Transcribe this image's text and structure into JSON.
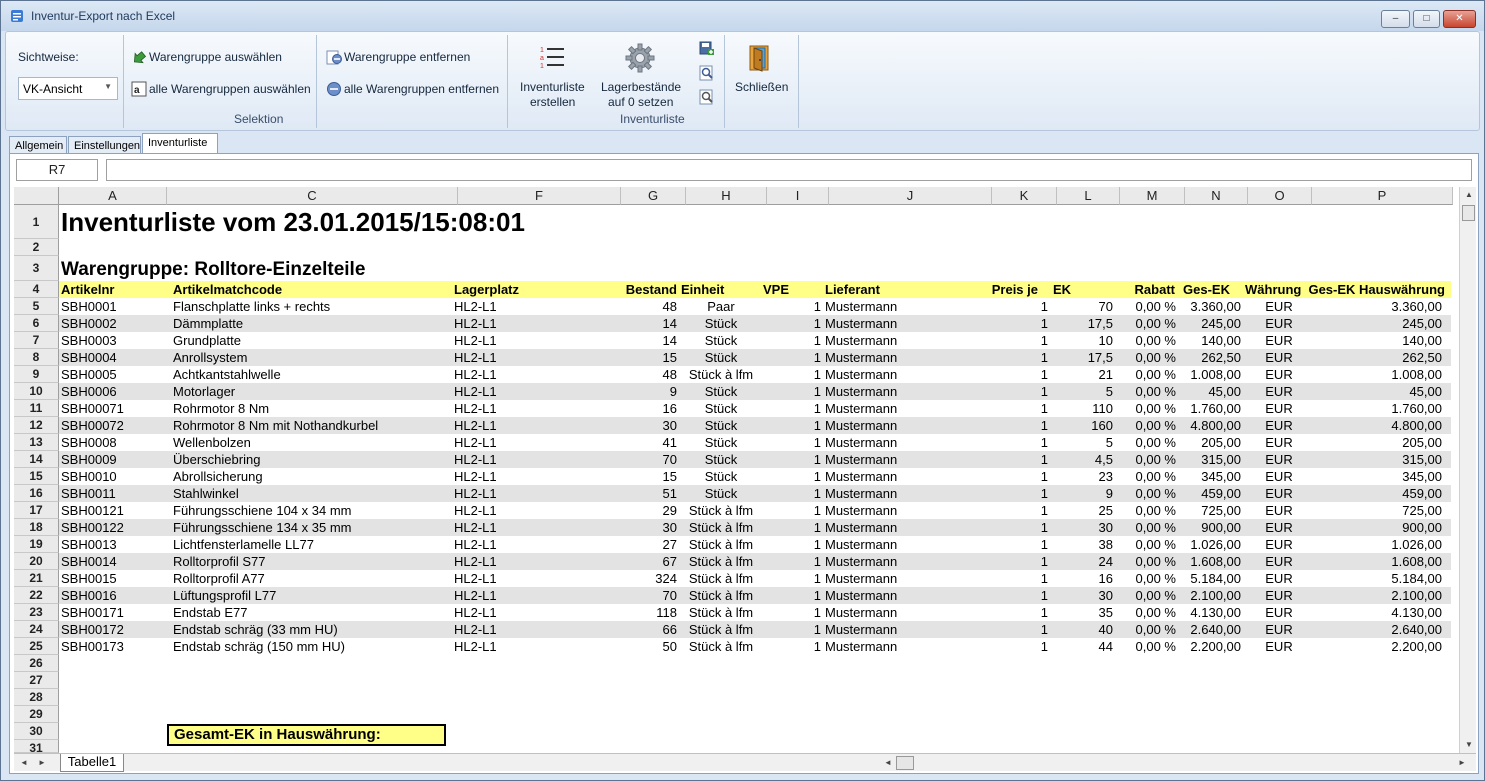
{
  "window": {
    "title": "Inventur-Export nach Excel",
    "minimize": "–",
    "maximize": "□",
    "close": "✕"
  },
  "ribbon": {
    "view_label": "Sichtweise:",
    "view_value": "VK-Ansicht",
    "select_group": "Warengruppe auswählen",
    "select_all_groups": "alle Warengruppen auswählen",
    "remove_group": "Warengruppe entfernen",
    "remove_all_groups": "alle Warengruppen entfernen",
    "selection_group_label": "Selektion",
    "create_list": "Inventurliste erstellen",
    "create_list_l1": "Inventurliste",
    "create_list_l2": "erstellen",
    "reset_stock_l1": "Lagerbestände",
    "reset_stock_l2": "auf 0 setzen",
    "inventory_group_label": "Inventurliste",
    "close": "Schließen"
  },
  "tabs": [
    "Allgemein",
    "Einstellungen",
    "Inventurliste"
  ],
  "active_tab": "Inventurliste",
  "spreadsheet": {
    "name_box": "R7",
    "formula": "",
    "columns": [
      "A",
      "C",
      "F",
      "G",
      "H",
      "I",
      "J",
      "K",
      "L",
      "M",
      "N",
      "O",
      "P"
    ],
    "row_numbers": [
      "1",
      "2",
      "3",
      "4",
      "5",
      "6",
      "7",
      "8",
      "9",
      "10",
      "11",
      "12",
      "13",
      "14",
      "15",
      "16",
      "17",
      "18",
      "19",
      "20",
      "21",
      "22",
      "23",
      "24",
      "25",
      "26",
      "27",
      "28",
      "29",
      "30",
      "31"
    ],
    "title": "Inventurliste vom 23.01.2015/15:08:01",
    "subtitle": "Warengruppe: Rolltore-Einzelteile",
    "headers": [
      "Artikelnr",
      "Artikelmatchcode",
      "Lagerplatz",
      "Bestand",
      "Einheit",
      "VPE",
      "Lieferant",
      "Preis je",
      "EK",
      "Rabatt",
      "Ges-EK",
      "Währung",
      "Ges-EK Hauswährung"
    ],
    "rows": [
      [
        "SBH0001",
        "Flanschplatte links + rechts",
        "HL2-L1",
        "48",
        "Paar",
        "1",
        "Mustermann",
        "1",
        "70",
        "0,00 %",
        "3.360,00",
        "EUR",
        "3.360,00"
      ],
      [
        "SBH0002",
        "Dämmplatte",
        "HL2-L1",
        "14",
        "Stück",
        "1",
        "Mustermann",
        "1",
        "17,5",
        "0,00 %",
        "245,00",
        "EUR",
        "245,00"
      ],
      [
        "SBH0003",
        "Grundplatte",
        "HL2-L1",
        "14",
        "Stück",
        "1",
        "Mustermann",
        "1",
        "10",
        "0,00 %",
        "140,00",
        "EUR",
        "140,00"
      ],
      [
        "SBH0004",
        "Anrollsystem",
        "HL2-L1",
        "15",
        "Stück",
        "1",
        "Mustermann",
        "1",
        "17,5",
        "0,00 %",
        "262,50",
        "EUR",
        "262,50"
      ],
      [
        "SBH0005",
        "Achtkantstahlwelle",
        "HL2-L1",
        "48",
        "Stück à lfm",
        "1",
        "Mustermann",
        "1",
        "21",
        "0,00 %",
        "1.008,00",
        "EUR",
        "1.008,00"
      ],
      [
        "SBH0006",
        "Motorlager",
        "HL2-L1",
        "9",
        "Stück",
        "1",
        "Mustermann",
        "1",
        "5",
        "0,00 %",
        "45,00",
        "EUR",
        "45,00"
      ],
      [
        "SBH00071",
        "Rohrmotor 8 Nm",
        "HL2-L1",
        "16",
        "Stück",
        "1",
        "Mustermann",
        "1",
        "110",
        "0,00 %",
        "1.760,00",
        "EUR",
        "1.760,00"
      ],
      [
        "SBH00072",
        "Rohrmotor 8 Nm mit Nothandkurbel",
        "HL2-L1",
        "30",
        "Stück",
        "1",
        "Mustermann",
        "1",
        "160",
        "0,00 %",
        "4.800,00",
        "EUR",
        "4.800,00"
      ],
      [
        "SBH0008",
        "Wellenbolzen",
        "HL2-L1",
        "41",
        "Stück",
        "1",
        "Mustermann",
        "1",
        "5",
        "0,00 %",
        "205,00",
        "EUR",
        "205,00"
      ],
      [
        "SBH0009",
        "Überschiebring",
        "HL2-L1",
        "70",
        "Stück",
        "1",
        "Mustermann",
        "1",
        "4,5",
        "0,00 %",
        "315,00",
        "EUR",
        "315,00"
      ],
      [
        "SBH0010",
        "Abrollsicherung",
        "HL2-L1",
        "15",
        "Stück",
        "1",
        "Mustermann",
        "1",
        "23",
        "0,00 %",
        "345,00",
        "EUR",
        "345,00"
      ],
      [
        "SBH0011",
        "Stahlwinkel",
        "HL2-L1",
        "51",
        "Stück",
        "1",
        "Mustermann",
        "1",
        "9",
        "0,00 %",
        "459,00",
        "EUR",
        "459,00"
      ],
      [
        "SBH00121",
        "Führungsschiene 104 x 34 mm",
        "HL2-L1",
        "29",
        "Stück à lfm",
        "1",
        "Mustermann",
        "1",
        "25",
        "0,00 %",
        "725,00",
        "EUR",
        "725,00"
      ],
      [
        "SBH00122",
        "Führungsschiene 134 x 35 mm",
        "HL2-L1",
        "30",
        "Stück à lfm",
        "1",
        "Mustermann",
        "1",
        "30",
        "0,00 %",
        "900,00",
        "EUR",
        "900,00"
      ],
      [
        "SBH0013",
        "Lichtfensterlamelle LL77",
        "HL2-L1",
        "27",
        "Stück à lfm",
        "1",
        "Mustermann",
        "1",
        "38",
        "0,00 %",
        "1.026,00",
        "EUR",
        "1.026,00"
      ],
      [
        "SBH0014",
        "Rolltorprofil S77",
        "HL2-L1",
        "67",
        "Stück à lfm",
        "1",
        "Mustermann",
        "1",
        "24",
        "0,00 %",
        "1.608,00",
        "EUR",
        "1.608,00"
      ],
      [
        "SBH0015",
        "Rolltorprofil A77",
        "HL2-L1",
        "324",
        "Stück à lfm",
        "1",
        "Mustermann",
        "1",
        "16",
        "0,00 %",
        "5.184,00",
        "EUR",
        "5.184,00"
      ],
      [
        "SBH0016",
        "Lüftungsprofil L77",
        "HL2-L1",
        "70",
        "Stück à lfm",
        "1",
        "Mustermann",
        "1",
        "30",
        "0,00 %",
        "2.100,00",
        "EUR",
        "2.100,00"
      ],
      [
        "SBH00171",
        "Endstab E77",
        "HL2-L1",
        "118",
        "Stück à lfm",
        "1",
        "Mustermann",
        "1",
        "35",
        "0,00 %",
        "4.130,00",
        "EUR",
        "4.130,00"
      ],
      [
        "SBH00172",
        "Endstab schräg (33 mm HU)",
        "HL2-L1",
        "66",
        "Stück à lfm",
        "1",
        "Mustermann",
        "1",
        "40",
        "0,00 %",
        "2.640,00",
        "EUR",
        "2.640,00"
      ],
      [
        "SBH00173",
        "Endstab schräg (150 mm HU)",
        "HL2-L1",
        "50",
        "Stück à lfm",
        "1",
        "Mustermann",
        "1",
        "44",
        "0,00 %",
        "2.200,00",
        "EUR",
        "2.200,00"
      ]
    ],
    "total_label": "Gesamt-EK in Hauswährung:",
    "sheet_tab": "Tabelle1",
    "header_color": "#ffff88",
    "stripe_color": "#e3e3e3"
  }
}
